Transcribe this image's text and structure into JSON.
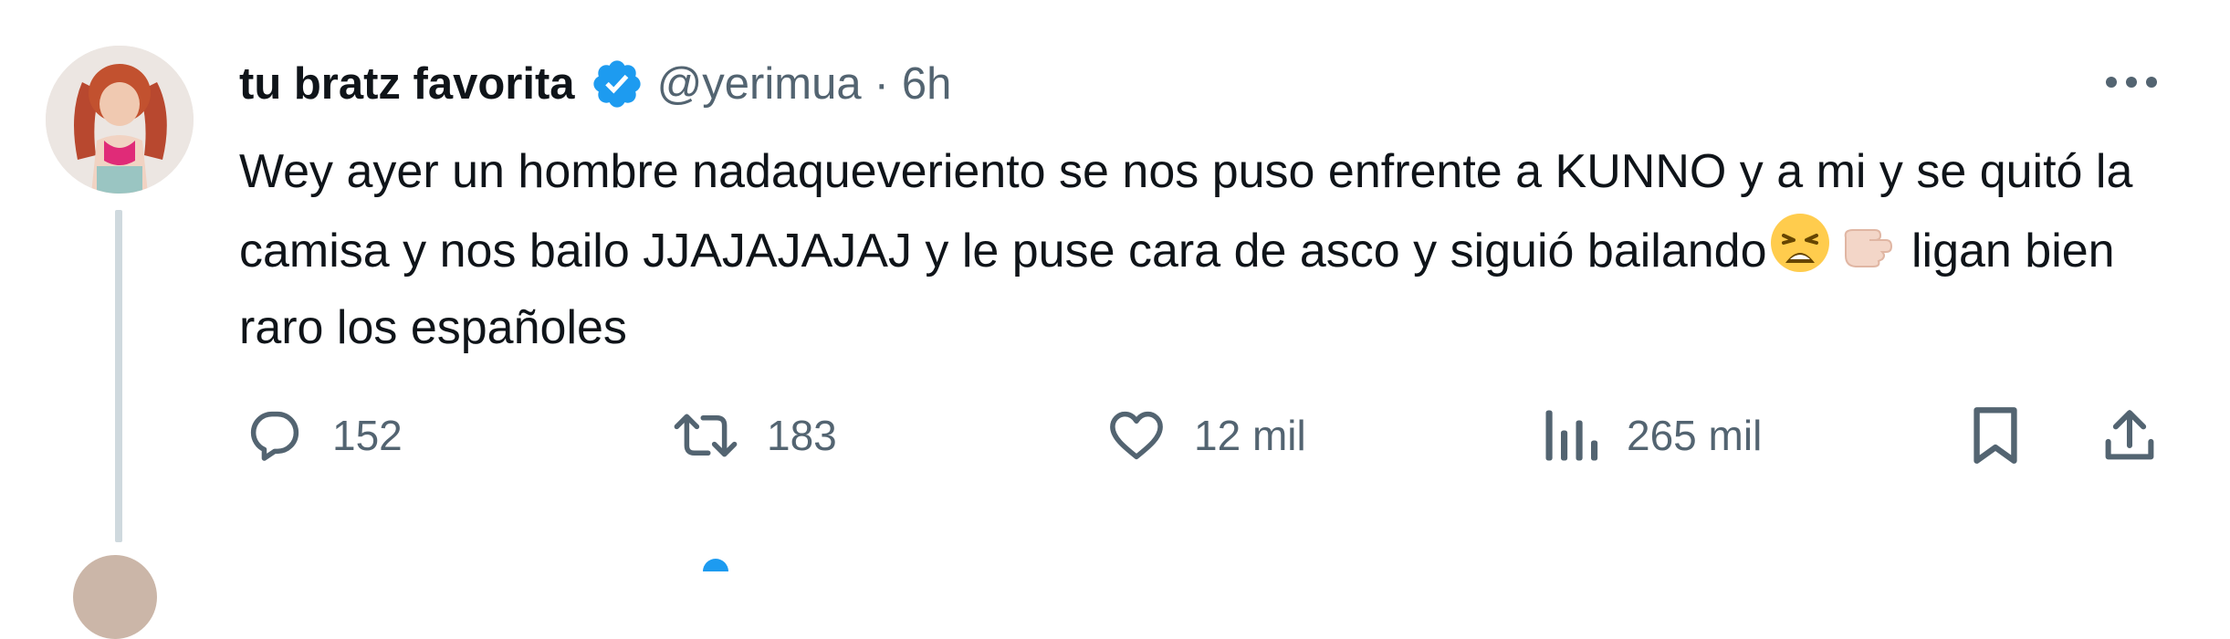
{
  "tweet": {
    "display_name": "tu bratz favorita",
    "handle": "@yerimua",
    "separator": "·",
    "time": "6h",
    "text_part1": "Wey ayer un hombre nadaqueveriento se nos puso enfrente a KUNNO y a mi y se quitó la camisa y nos bailo JJAJAJAJAJ y le puse cara de asco y siguió bailando",
    "text_part2": " ligan bien raro los españoles",
    "emojis": [
      "weary-face-emoji",
      "pointing-hand-emoji"
    ]
  },
  "actions": {
    "replies": "152",
    "retweets": "183",
    "likes": "12 mil",
    "views": "265 mil"
  },
  "colors": {
    "text": "#0f1419",
    "secondary": "#536471",
    "verified": "#1d9bf0",
    "thread_line": "#cfd9de"
  },
  "icons": [
    "avatar",
    "verified-badge-icon",
    "more-icon",
    "reply-icon",
    "retweet-icon",
    "like-icon",
    "views-icon",
    "bookmark-icon",
    "share-icon"
  ]
}
